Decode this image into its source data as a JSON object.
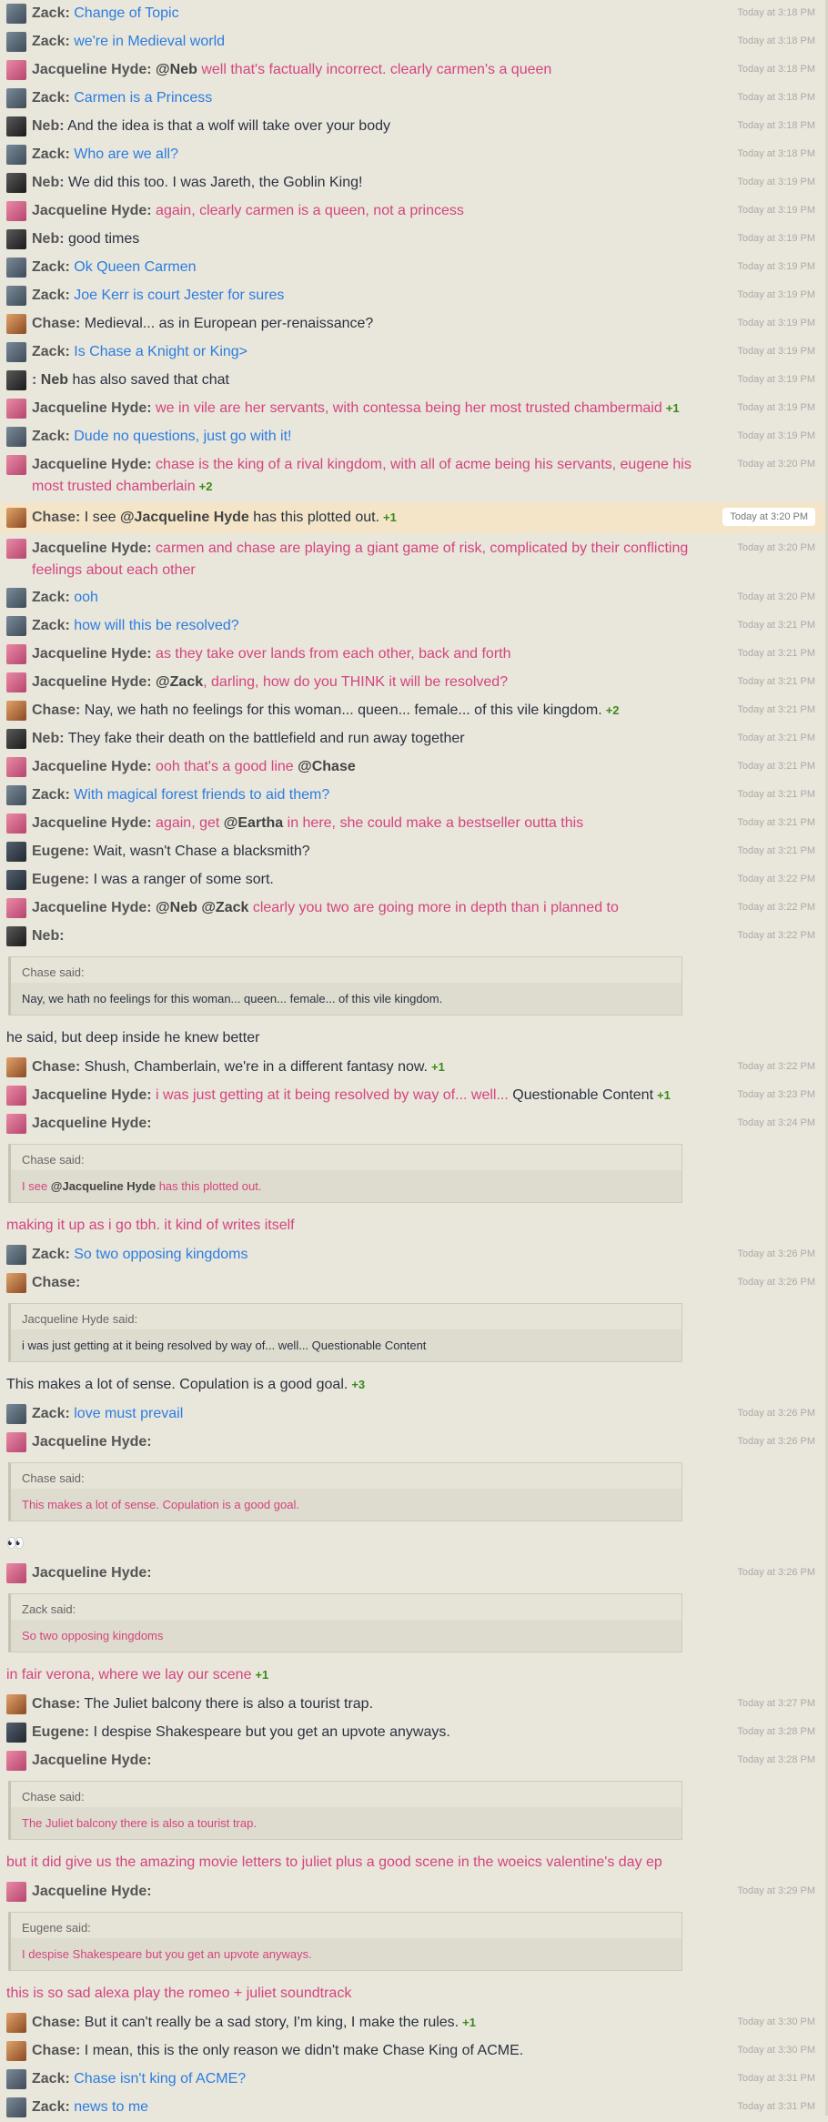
{
  "messages": [
    {
      "kind": "msg",
      "user": "zack",
      "name": "Zack:",
      "parts": [
        {
          "c": "t-blue",
          "t": " Change of Topic"
        }
      ],
      "ts": "Today at 3:18 PM"
    },
    {
      "kind": "msg",
      "user": "zack",
      "name": "Zack:",
      "parts": [
        {
          "c": "t-blue",
          "t": " we're in Medieval world"
        }
      ],
      "ts": "Today at 3:18 PM"
    },
    {
      "kind": "msg",
      "user": "jac",
      "name": "Jacqueline Hyde:",
      "parts": [
        {
          "c": "mention",
          "t": " @Neb"
        },
        {
          "c": "t-pink",
          "t": " well that's factually incorrect. clearly carmen's a queen"
        }
      ],
      "ts": "Today at 3:18 PM"
    },
    {
      "kind": "msg",
      "user": "zack",
      "name": "Zack:",
      "parts": [
        {
          "c": "t-blue",
          "t": " Carmen is a Princess"
        }
      ],
      "ts": "Today at 3:18 PM"
    },
    {
      "kind": "msg",
      "user": "neb",
      "name": "Neb:",
      "parts": [
        {
          "c": "t-dark",
          "t": " And the idea is that a wolf will take over your body"
        }
      ],
      "ts": "Today at 3:18 PM"
    },
    {
      "kind": "msg",
      "user": "zack",
      "name": "Zack:",
      "parts": [
        {
          "c": "t-blue",
          "t": " Who are we all?"
        }
      ],
      "ts": "Today at 3:18 PM"
    },
    {
      "kind": "msg",
      "user": "neb",
      "name": "Neb:",
      "parts": [
        {
          "c": "t-dark",
          "t": " We did this too. I was Jareth, the Goblin King!"
        }
      ],
      "ts": "Today at 3:19 PM"
    },
    {
      "kind": "msg",
      "user": "jac",
      "name": "Jacqueline Hyde:",
      "parts": [
        {
          "c": "t-pink",
          "t": " again, clearly carmen is a queen, not a princess"
        }
      ],
      "ts": "Today at 3:19 PM"
    },
    {
      "kind": "msg",
      "user": "neb",
      "name": "Neb:",
      "parts": [
        {
          "c": "t-dark",
          "t": " good times"
        }
      ],
      "ts": "Today at 3:19 PM"
    },
    {
      "kind": "msg",
      "user": "zack",
      "name": "Zack:",
      "parts": [
        {
          "c": "t-blue",
          "t": " Ok Queen Carmen"
        }
      ],
      "ts": "Today at 3:19 PM"
    },
    {
      "kind": "msg",
      "user": "zack",
      "name": "Zack:",
      "parts": [
        {
          "c": "t-blue",
          "t": " Joe Kerr is court Jester for sures"
        }
      ],
      "ts": "Today at 3:19 PM"
    },
    {
      "kind": "msg",
      "user": "chase",
      "name": "Chase:",
      "parts": [
        {
          "c": "t-dark",
          "t": " Medieval... as in European per-renaissance?"
        }
      ],
      "ts": "Today at 3:19 PM"
    },
    {
      "kind": "msg",
      "user": "zack",
      "name": "Zack:",
      "parts": [
        {
          "c": "t-blue",
          "t": " Is Chase a Knight or King>"
        }
      ],
      "ts": "Today at 3:19 PM"
    },
    {
      "kind": "msg",
      "user": "neb",
      "name": ":",
      "parts": [
        {
          "c": "mention",
          "t": " Neb"
        },
        {
          "c": "t-dark",
          "t": " has also saved that chat"
        }
      ],
      "ts": "Today at 3:19 PM"
    },
    {
      "kind": "msg",
      "user": "jac",
      "name": "Jacqueline Hyde:",
      "parts": [
        {
          "c": "t-pink",
          "t": " we in vile are her servants, with contessa being her most trusted chambermaid"
        }
      ],
      "vote": "+1",
      "ts": "Today at 3:19 PM"
    },
    {
      "kind": "msg",
      "user": "zack",
      "name": "Zack:",
      "parts": [
        {
          "c": "t-blue",
          "t": " Dude no questions, just go with it!"
        }
      ],
      "ts": "Today at 3:19 PM"
    },
    {
      "kind": "msg",
      "user": "jac",
      "name": "Jacqueline Hyde:",
      "parts": [
        {
          "c": "t-pink",
          "t": " chase is the king of a rival kingdom, with all of acme being his servants, eugene his most trusted chamberlain"
        }
      ],
      "vote": "+2",
      "ts": "Today at 3:20 PM"
    },
    {
      "kind": "msg",
      "hl": true,
      "user": "chase",
      "name": "Chase:",
      "parts": [
        {
          "c": "t-dark",
          "t": " I see "
        },
        {
          "c": "mention",
          "t": "@Jacqueline Hyde"
        },
        {
          "c": "t-dark",
          "t": " has this plotted out."
        }
      ],
      "vote": "+1",
      "ts": "Today at 3:20 PM"
    },
    {
      "kind": "msg",
      "user": "jac",
      "name": "Jacqueline Hyde:",
      "parts": [
        {
          "c": "t-pink",
          "t": " carmen and chase are playing a giant game of risk, complicated by their conflicting feelings about each other"
        }
      ],
      "ts": "Today at 3:20 PM"
    },
    {
      "kind": "msg",
      "user": "zack",
      "name": "Zack:",
      "parts": [
        {
          "c": "t-blue",
          "t": " ooh"
        }
      ],
      "ts": "Today at 3:20 PM"
    },
    {
      "kind": "msg",
      "user": "zack",
      "name": "Zack:",
      "parts": [
        {
          "c": "t-blue",
          "t": " how will this be resolved?"
        }
      ],
      "ts": "Today at 3:21 PM"
    },
    {
      "kind": "msg",
      "user": "jac",
      "name": "Jacqueline Hyde:",
      "parts": [
        {
          "c": "t-pink",
          "t": " as they take over lands from each other, back and forth"
        }
      ],
      "ts": "Today at 3:21 PM"
    },
    {
      "kind": "msg",
      "user": "jac",
      "name": "Jacqueline Hyde:",
      "parts": [
        {
          "c": "mention",
          "t": " @Zack"
        },
        {
          "c": "t-pink",
          "t": ", darling, how do you THINK it will be resolved?"
        }
      ],
      "ts": "Today at 3:21 PM"
    },
    {
      "kind": "msg",
      "user": "chase",
      "name": "Chase:",
      "parts": [
        {
          "c": "t-dark",
          "t": " Nay, we hath no feelings for this woman... queen... female... of this vile kingdom."
        }
      ],
      "vote": "+2",
      "ts": "Today at 3:21 PM"
    },
    {
      "kind": "msg",
      "user": "neb",
      "name": "Neb:",
      "parts": [
        {
          "c": "t-dark",
          "t": " They fake their death on the battlefield and run away together"
        }
      ],
      "ts": "Today at 3:21 PM"
    },
    {
      "kind": "msg",
      "user": "jac",
      "name": "Jacqueline Hyde:",
      "parts": [
        {
          "c": "t-pink",
          "t": " ooh that's a good line "
        },
        {
          "c": "mention",
          "t": "@Chase"
        }
      ],
      "ts": "Today at 3:21 PM"
    },
    {
      "kind": "msg",
      "user": "zack",
      "name": "Zack:",
      "parts": [
        {
          "c": "t-blue",
          "t": " With magical forest friends to aid them?"
        }
      ],
      "ts": "Today at 3:21 PM"
    },
    {
      "kind": "msg",
      "user": "jac",
      "name": "Jacqueline Hyde:",
      "parts": [
        {
          "c": "t-pink",
          "t": " again, get "
        },
        {
          "c": "mention",
          "t": "@Eartha"
        },
        {
          "c": "t-pink",
          "t": " in here, she could make a bestseller outta this"
        }
      ],
      "ts": "Today at 3:21 PM"
    },
    {
      "kind": "msg",
      "user": "eug",
      "name": "Eugene:",
      "parts": [
        {
          "c": "t-dark",
          "t": " Wait, wasn't Chase a blacksmith?"
        }
      ],
      "ts": "Today at 3:21 PM"
    },
    {
      "kind": "msg",
      "user": "eug",
      "name": "Eugene:",
      "parts": [
        {
          "c": "t-dark",
          "t": " I was a ranger of some sort."
        }
      ],
      "ts": "Today at 3:22 PM"
    },
    {
      "kind": "msg",
      "user": "jac",
      "name": "Jacqueline Hyde:",
      "parts": [
        {
          "c": "mention",
          "t": " @Neb @Zack"
        },
        {
          "c": "t-pink",
          "t": " clearly you two are going more in depth than i planned to"
        }
      ],
      "ts": "Today at 3:22 PM"
    },
    {
      "kind": "msg",
      "user": "neb",
      "name": "Neb:",
      "parts": [],
      "ts": "Today at 3:22 PM"
    },
    {
      "kind": "quote",
      "head": "Chase said:",
      "parts": [
        {
          "c": "t-dark",
          "t": "Nay, we hath no feelings for this woman... queen... female... of this vile kingdom."
        }
      ]
    },
    {
      "kind": "plain",
      "parts": [
        {
          "c": "t-dark",
          "t": "he said, but deep inside he knew better"
        }
      ]
    },
    {
      "kind": "msg",
      "user": "chase",
      "name": "Chase:",
      "parts": [
        {
          "c": "t-dark",
          "t": " Shush, Chamberlain, we're in a different fantasy now."
        }
      ],
      "vote": "+1",
      "ts": "Today at 3:22 PM"
    },
    {
      "kind": "msg",
      "user": "jac",
      "name": "Jacqueline Hyde:",
      "parts": [
        {
          "c": "t-pink",
          "t": " i was just getting at it being resolved by way of... well..."
        },
        {
          "c": "t-dark",
          "t": " Questionable Content"
        }
      ],
      "vote": "+1",
      "ts": "Today at 3:23 PM"
    },
    {
      "kind": "msg",
      "user": "jac",
      "name": "Jacqueline Hyde:",
      "parts": [],
      "ts": "Today at 3:24 PM"
    },
    {
      "kind": "quote",
      "head": "Chase said:",
      "parts": [
        {
          "c": "t-pink",
          "t": "I see "
        },
        {
          "c": "mention",
          "t": "@Jacqueline Hyde"
        },
        {
          "c": "t-pink",
          "t": " has this plotted out."
        }
      ]
    },
    {
      "kind": "plain",
      "parts": [
        {
          "c": "t-pink",
          "t": "making it up as i go tbh. it kind of writes itself"
        }
      ]
    },
    {
      "kind": "msg",
      "user": "zack",
      "name": "Zack:",
      "parts": [
        {
          "c": "t-blue",
          "t": " So two opposing kingdoms"
        }
      ],
      "ts": "Today at 3:26 PM"
    },
    {
      "kind": "msg",
      "user": "chase",
      "name": "Chase:",
      "parts": [],
      "ts": "Today at 3:26 PM"
    },
    {
      "kind": "quote",
      "head": "Jacqueline Hyde said:",
      "parts": [
        {
          "c": "t-dark",
          "t": "i was just getting at it being resolved by way of... well... Questionable Content"
        }
      ]
    },
    {
      "kind": "plain",
      "parts": [
        {
          "c": "t-dark",
          "t": "This makes a lot of sense. Copulation is a good goal."
        }
      ],
      "vote": "+3"
    },
    {
      "kind": "msg",
      "user": "zack",
      "name": "Zack:",
      "parts": [
        {
          "c": "t-blue",
          "t": " love must prevail"
        }
      ],
      "ts": "Today at 3:26 PM"
    },
    {
      "kind": "msg",
      "user": "jac",
      "name": "Jacqueline Hyde:",
      "parts": [],
      "ts": "Today at 3:26 PM"
    },
    {
      "kind": "quote",
      "head": "Chase said:",
      "parts": [
        {
          "c": "t-pink",
          "t": "This makes a lot of sense. Copulation is a good goal."
        }
      ]
    },
    {
      "kind": "plain",
      "parts": [
        {
          "c": "t-dark",
          "t": "👀"
        }
      ]
    },
    {
      "kind": "msg",
      "user": "jac",
      "name": "Jacqueline Hyde:",
      "parts": [],
      "ts": "Today at 3:26 PM"
    },
    {
      "kind": "quote",
      "head": "Zack said:",
      "parts": [
        {
          "c": "t-pink",
          "t": "So two opposing kingdoms"
        }
      ]
    },
    {
      "kind": "plain",
      "parts": [
        {
          "c": "t-pink",
          "t": "in fair verona, where we lay our scene"
        }
      ],
      "vote": "+1"
    },
    {
      "kind": "msg",
      "user": "chase",
      "name": "Chase:",
      "parts": [
        {
          "c": "t-dark",
          "t": " The Juliet balcony there is also a tourist trap."
        }
      ],
      "ts": "Today at 3:27 PM"
    },
    {
      "kind": "msg",
      "user": "eug",
      "name": "Eugene:",
      "parts": [
        {
          "c": "t-dark",
          "t": " I despise Shakespeare but you get an upvote anyways."
        }
      ],
      "ts": "Today at 3:28 PM"
    },
    {
      "kind": "msg",
      "user": "jac",
      "name": "Jacqueline Hyde:",
      "parts": [],
      "ts": "Today at 3:28 PM"
    },
    {
      "kind": "quote",
      "head": "Chase said:",
      "parts": [
        {
          "c": "t-pink",
          "t": "The Juliet balcony there is also a tourist trap."
        }
      ]
    },
    {
      "kind": "plain",
      "parts": [
        {
          "c": "t-pink",
          "t": "but it did give us the amazing movie letters to juliet plus a good scene in the woeics valentine's day ep"
        }
      ]
    },
    {
      "kind": "msg",
      "user": "jac",
      "name": "Jacqueline Hyde:",
      "parts": [],
      "ts": "Today at 3:29 PM"
    },
    {
      "kind": "quote",
      "head": "Eugene said:",
      "parts": [
        {
          "c": "t-pink",
          "t": "I despise Shakespeare but you get an upvote anyways."
        }
      ]
    },
    {
      "kind": "plain",
      "parts": [
        {
          "c": "t-pink",
          "t": "this is so sad alexa play the romeo + juliet soundtrack"
        }
      ]
    },
    {
      "kind": "msg",
      "user": "chase",
      "name": "Chase:",
      "parts": [
        {
          "c": "t-dark",
          "t": " But it can't really be a sad story, I'm king, I make the rules."
        }
      ],
      "vote": "+1",
      "ts": "Today at 3:30 PM"
    },
    {
      "kind": "msg",
      "user": "chase",
      "name": "Chase:",
      "parts": [
        {
          "c": "t-dark",
          "t": " I mean, this is the only reason we didn't make Chase King of ACME."
        }
      ],
      "ts": "Today at 3:30 PM"
    },
    {
      "kind": "msg",
      "user": "zack",
      "name": "Zack:",
      "parts": [
        {
          "c": "t-blue",
          "t": " Chase isn't king of ACME?"
        }
      ],
      "ts": "Today at 3:31 PM"
    },
    {
      "kind": "msg",
      "user": "zack",
      "name": "Zack:",
      "parts": [
        {
          "c": "t-blue",
          "t": " news to me"
        }
      ],
      "ts": "Today at 3:31 PM"
    }
  ]
}
